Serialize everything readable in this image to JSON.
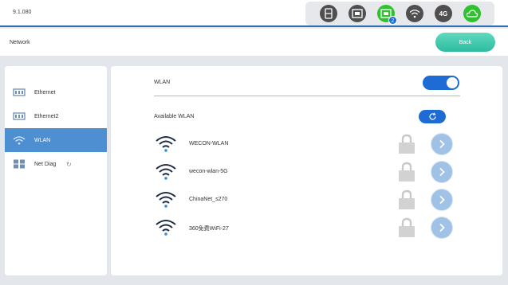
{
  "topbar": {
    "version": "9.1.080",
    "icons": [
      {
        "name": "storage-icon"
      },
      {
        "name": "ethernet-icon"
      },
      {
        "name": "ethernet-active-icon",
        "badge": "2"
      },
      {
        "name": "wifi-status-icon"
      },
      {
        "name": "cellular-4g-icon",
        "text": "4G"
      },
      {
        "name": "cloud-icon"
      }
    ],
    "accent_color": "#2e6db4",
    "active_color": "#2fc22e"
  },
  "header": {
    "title": "Network",
    "back_label": "Back"
  },
  "sidebar": {
    "items": [
      {
        "label": "Ethernet",
        "icon": "ethernet-icon"
      },
      {
        "label": "Ethernet2",
        "icon": "ethernet-icon"
      },
      {
        "label": "WLAN",
        "icon": "wifi-icon",
        "active": true
      },
      {
        "label": "Net Diag",
        "icon": "grid-icon",
        "extra_icon": "refresh-icon"
      }
    ]
  },
  "main": {
    "wlan_label": "WLAN",
    "wlan_enabled": true,
    "available_label": "Available WLAN",
    "networks": [
      {
        "name": "WECON-WLAN",
        "locked": true
      },
      {
        "name": "wecon-wlan-5G",
        "locked": true
      },
      {
        "name": "ChinaNet_s270",
        "locked": true
      },
      {
        "name": "360免费WiFi-27",
        "locked": true
      }
    ]
  }
}
